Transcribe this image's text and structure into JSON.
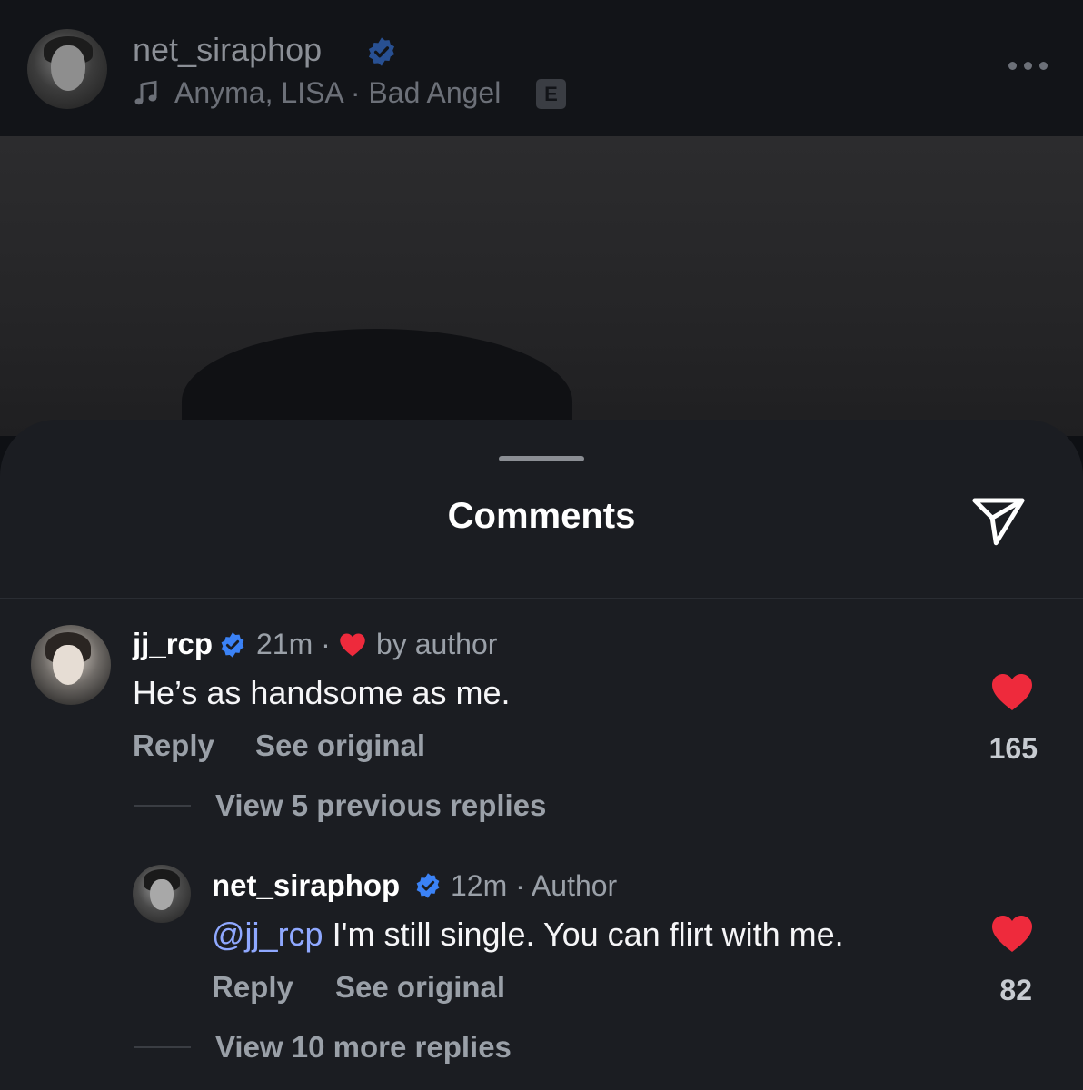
{
  "post": {
    "username": "net_siraphop",
    "music": "Anyma, LISA · Bad Angel",
    "explicit": "E"
  },
  "sheet": {
    "title": "Comments"
  },
  "comments": [
    {
      "username": "jj_rcp",
      "time": "21m ·",
      "liked_by": "by author",
      "text": "He’s as handsome as me.",
      "reply": "Reply",
      "see_original": "See original",
      "likes": "165",
      "view_replies": "View 5 previous replies"
    }
  ],
  "reply": {
    "username": "net_siraphop",
    "time": "12m · Author",
    "mention": "@jj_rcp",
    "text": " I'm still single. You can flirt with me.",
    "reply": "Reply",
    "see_original": "See original",
    "likes": "82",
    "view_more": "View 10 more replies"
  },
  "colors": {
    "verified": "#3b82f6",
    "heart": "#ee2a3c",
    "mention": "#8fa8ff"
  }
}
